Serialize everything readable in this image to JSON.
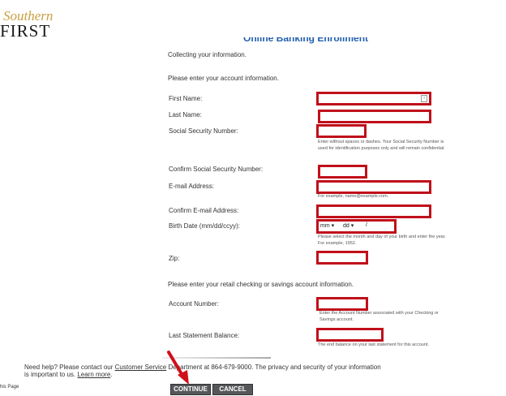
{
  "brand": {
    "line1": "Southern",
    "line2": "FIRST"
  },
  "title": "Online Banking Enrollment",
  "step_text": "Collecting your information.",
  "section_account": "Please enter your account information.",
  "fields": {
    "first_name": "First Name:",
    "last_name": "Last Name:",
    "ssn": "Social Security Number:",
    "ssn_hint": "Enter without spaces or dashes. Your Social Security Number is used for identification purposes only and will remain confidential.",
    "confirm_ssn": "Confirm Social Security Number:",
    "email": "E-mail Address:",
    "email_hint": "For example, name@example.com.",
    "confirm_email": "Confirm E-mail Address:",
    "birth": "Birth Date (mm/dd/ccyy):",
    "birth_mm": "mm ▾",
    "birth_dd": "dd ▾",
    "birth_hint": "Please select the month and day of your birth and enter the year. For example, 1952.",
    "zip": "Zip:"
  },
  "section_retail": "Please enter your retail checking or savings account information.",
  "retail": {
    "account_number": "Account Number:",
    "account_hint": "Enter the Account Number associated with your Checking or Savings account.",
    "balance": "Last Statement Balance:",
    "balance_hint": "The end balance on your last statement for this account."
  },
  "help": {
    "pre": "Need help? Please contact our ",
    "link1": "Customer Service",
    "mid": " Department at 864-679-9000. The privacy and security of your information is important to us. ",
    "link2": "Learn more",
    "post": "."
  },
  "side_text": "his Page",
  "buttons": {
    "continue": "CONTINUE",
    "cancel": "CANCEL"
  },
  "colors": {
    "highlight": "#c0101a",
    "title": "#1f5fae",
    "button": "#55575a"
  }
}
